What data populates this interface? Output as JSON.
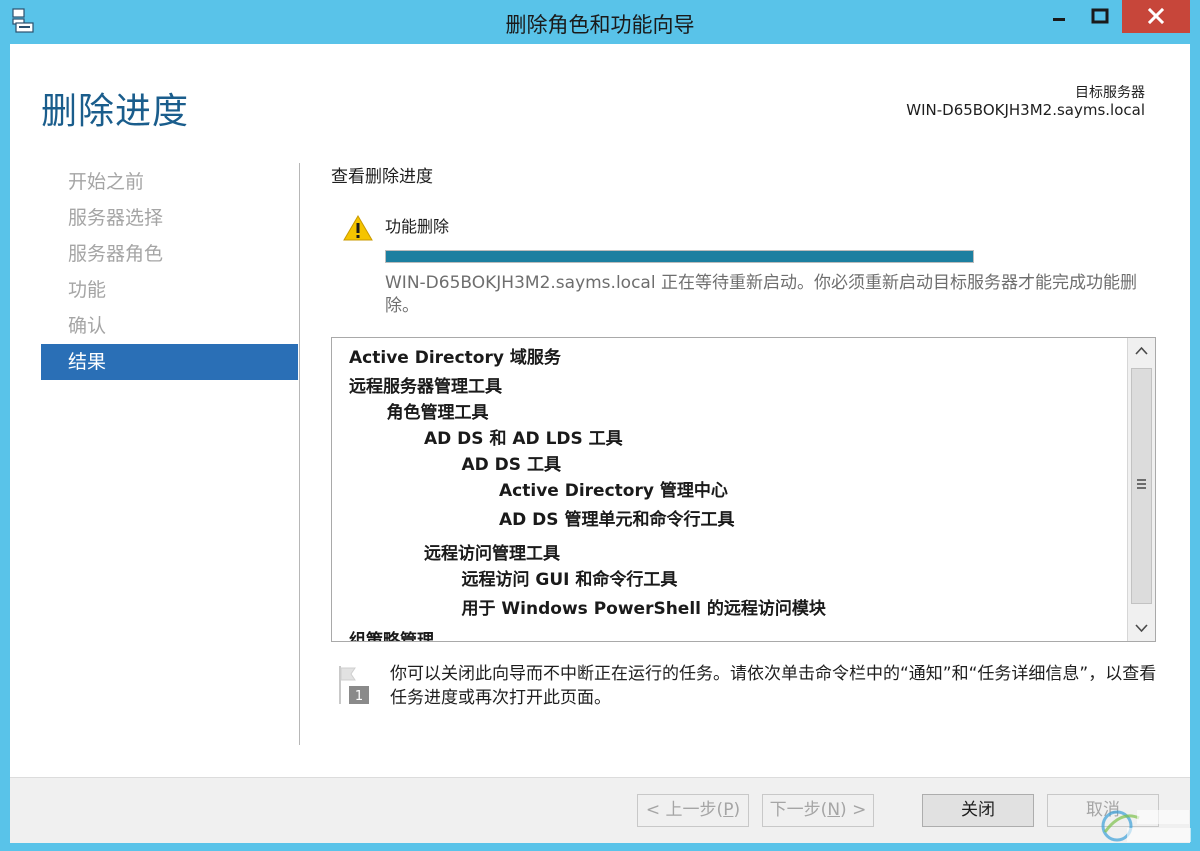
{
  "window": {
    "title": "删除角色和功能向导",
    "controls": {
      "minimize_icon": "minimize-icon",
      "maximize_icon": "maximize-icon",
      "close_icon": "close-icon"
    }
  },
  "header": {
    "page_title": "删除进度",
    "target_server_label": "目标服务器",
    "target_server_value": "WIN-D65BOKJH3M2.sayms.local"
  },
  "steps": [
    {
      "label": "开始之前",
      "active": false
    },
    {
      "label": "服务器选择",
      "active": false
    },
    {
      "label": "服务器角色",
      "active": false
    },
    {
      "label": "功能",
      "active": false
    },
    {
      "label": "确认",
      "active": false
    },
    {
      "label": "结果",
      "active": true
    }
  ],
  "main": {
    "section_heading": "查看删除进度",
    "status_title": "功能删除",
    "status_icon": "warning-icon",
    "progress_fraction": 1.0,
    "status_message": "WIN-D65BOKJH3M2.sayms.local 正在等待重新启动。你必须重新启动目标服务器才能完成功能删除。",
    "feature_list": [
      {
        "text": "Active Directory 域服务",
        "level": 0
      },
      {
        "text": "远程服务器管理工具",
        "level": 0
      },
      {
        "text": "角色管理工具",
        "level": 1
      },
      {
        "text": "AD DS 和 AD LDS 工具",
        "level": 2
      },
      {
        "text": "AD DS 工具",
        "level": 3
      },
      {
        "text": "Active Directory 管理中心",
        "level": 4
      },
      {
        "text": "AD DS 管理单元和命令行工具",
        "level": 4
      },
      {
        "text": "远程访问管理工具",
        "level": 2
      },
      {
        "text": "远程访问 GUI 和命令行工具",
        "level": 3
      },
      {
        "text": "用于 Windows PowerShell 的远程访问模块",
        "level": 3
      },
      {
        "text": "组策略管理",
        "level": 0
      }
    ],
    "note_icon": "flag-icon",
    "note_text": "你可以关闭此向导而不中断正在运行的任务。请依次单击命令栏中的“通知”和“任务详细信息”，以查看任务进度或再次打开此页面。"
  },
  "footer": {
    "prev_label": "< 上一步(",
    "prev_key": "P",
    "prev_tail": ")",
    "next_label": "下一步(",
    "next_key": "N",
    "next_tail": ") >",
    "close_label": "关闭",
    "cancel_label": "取消"
  }
}
